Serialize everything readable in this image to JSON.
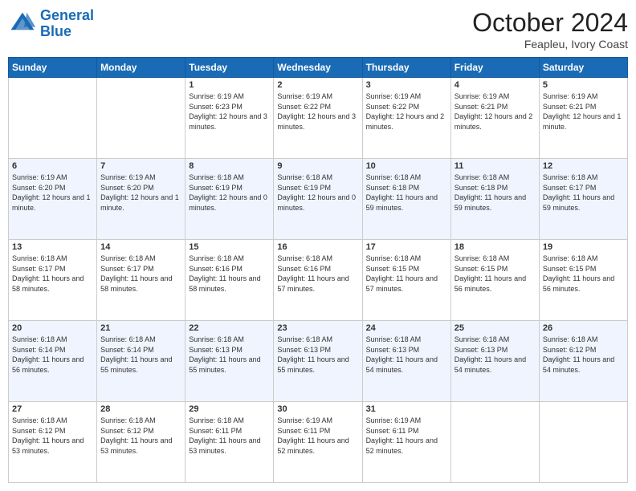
{
  "logo": {
    "line1": "General",
    "line2": "Blue"
  },
  "header": {
    "month": "October 2024",
    "location": "Feapleu, Ivory Coast"
  },
  "weekdays": [
    "Sunday",
    "Monday",
    "Tuesday",
    "Wednesday",
    "Thursday",
    "Friday",
    "Saturday"
  ],
  "weeks": [
    [
      {
        "day": "",
        "info": ""
      },
      {
        "day": "",
        "info": ""
      },
      {
        "day": "1",
        "info": "Sunrise: 6:19 AM\nSunset: 6:23 PM\nDaylight: 12 hours and 3 minutes."
      },
      {
        "day": "2",
        "info": "Sunrise: 6:19 AM\nSunset: 6:22 PM\nDaylight: 12 hours and 3 minutes."
      },
      {
        "day": "3",
        "info": "Sunrise: 6:19 AM\nSunset: 6:22 PM\nDaylight: 12 hours and 2 minutes."
      },
      {
        "day": "4",
        "info": "Sunrise: 6:19 AM\nSunset: 6:21 PM\nDaylight: 12 hours and 2 minutes."
      },
      {
        "day": "5",
        "info": "Sunrise: 6:19 AM\nSunset: 6:21 PM\nDaylight: 12 hours and 1 minute."
      }
    ],
    [
      {
        "day": "6",
        "info": "Sunrise: 6:19 AM\nSunset: 6:20 PM\nDaylight: 12 hours and 1 minute."
      },
      {
        "day": "7",
        "info": "Sunrise: 6:19 AM\nSunset: 6:20 PM\nDaylight: 12 hours and 1 minute."
      },
      {
        "day": "8",
        "info": "Sunrise: 6:18 AM\nSunset: 6:19 PM\nDaylight: 12 hours and 0 minutes."
      },
      {
        "day": "9",
        "info": "Sunrise: 6:18 AM\nSunset: 6:19 PM\nDaylight: 12 hours and 0 minutes."
      },
      {
        "day": "10",
        "info": "Sunrise: 6:18 AM\nSunset: 6:18 PM\nDaylight: 11 hours and 59 minutes."
      },
      {
        "day": "11",
        "info": "Sunrise: 6:18 AM\nSunset: 6:18 PM\nDaylight: 11 hours and 59 minutes."
      },
      {
        "day": "12",
        "info": "Sunrise: 6:18 AM\nSunset: 6:17 PM\nDaylight: 11 hours and 59 minutes."
      }
    ],
    [
      {
        "day": "13",
        "info": "Sunrise: 6:18 AM\nSunset: 6:17 PM\nDaylight: 11 hours and 58 minutes."
      },
      {
        "day": "14",
        "info": "Sunrise: 6:18 AM\nSunset: 6:17 PM\nDaylight: 11 hours and 58 minutes."
      },
      {
        "day": "15",
        "info": "Sunrise: 6:18 AM\nSunset: 6:16 PM\nDaylight: 11 hours and 58 minutes."
      },
      {
        "day": "16",
        "info": "Sunrise: 6:18 AM\nSunset: 6:16 PM\nDaylight: 11 hours and 57 minutes."
      },
      {
        "day": "17",
        "info": "Sunrise: 6:18 AM\nSunset: 6:15 PM\nDaylight: 11 hours and 57 minutes."
      },
      {
        "day": "18",
        "info": "Sunrise: 6:18 AM\nSunset: 6:15 PM\nDaylight: 11 hours and 56 minutes."
      },
      {
        "day": "19",
        "info": "Sunrise: 6:18 AM\nSunset: 6:15 PM\nDaylight: 11 hours and 56 minutes."
      }
    ],
    [
      {
        "day": "20",
        "info": "Sunrise: 6:18 AM\nSunset: 6:14 PM\nDaylight: 11 hours and 56 minutes."
      },
      {
        "day": "21",
        "info": "Sunrise: 6:18 AM\nSunset: 6:14 PM\nDaylight: 11 hours and 55 minutes."
      },
      {
        "day": "22",
        "info": "Sunrise: 6:18 AM\nSunset: 6:13 PM\nDaylight: 11 hours and 55 minutes."
      },
      {
        "day": "23",
        "info": "Sunrise: 6:18 AM\nSunset: 6:13 PM\nDaylight: 11 hours and 55 minutes."
      },
      {
        "day": "24",
        "info": "Sunrise: 6:18 AM\nSunset: 6:13 PM\nDaylight: 11 hours and 54 minutes."
      },
      {
        "day": "25",
        "info": "Sunrise: 6:18 AM\nSunset: 6:13 PM\nDaylight: 11 hours and 54 minutes."
      },
      {
        "day": "26",
        "info": "Sunrise: 6:18 AM\nSunset: 6:12 PM\nDaylight: 11 hours and 54 minutes."
      }
    ],
    [
      {
        "day": "27",
        "info": "Sunrise: 6:18 AM\nSunset: 6:12 PM\nDaylight: 11 hours and 53 minutes."
      },
      {
        "day": "28",
        "info": "Sunrise: 6:18 AM\nSunset: 6:12 PM\nDaylight: 11 hours and 53 minutes."
      },
      {
        "day": "29",
        "info": "Sunrise: 6:18 AM\nSunset: 6:11 PM\nDaylight: 11 hours and 53 minutes."
      },
      {
        "day": "30",
        "info": "Sunrise: 6:19 AM\nSunset: 6:11 PM\nDaylight: 11 hours and 52 minutes."
      },
      {
        "day": "31",
        "info": "Sunrise: 6:19 AM\nSunset: 6:11 PM\nDaylight: 11 hours and 52 minutes."
      },
      {
        "day": "",
        "info": ""
      },
      {
        "day": "",
        "info": ""
      }
    ]
  ]
}
